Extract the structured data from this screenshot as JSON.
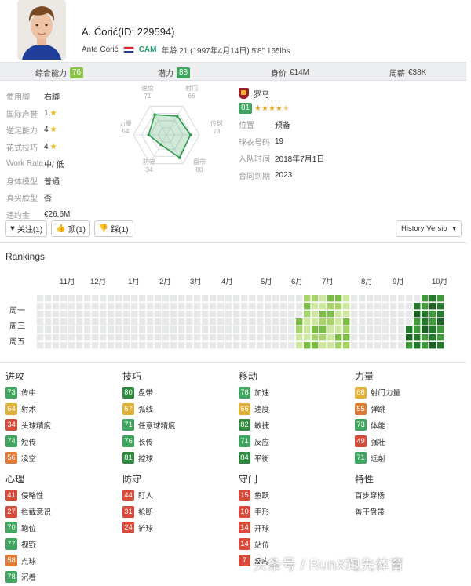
{
  "player": {
    "title": "A. Ćorić(ID: 229594)",
    "full_name": "Ante Ćorić",
    "position": "CAM",
    "details": "年龄 21 (1997年4月14日) 5'8\" 165lbs"
  },
  "stats_bar": {
    "overall_label": "综合能力",
    "overall": "76",
    "potential_label": "潜力",
    "potential": "88",
    "value_label": "身价",
    "value": "€14M",
    "wage_label": "周薪",
    "wage": "€38K"
  },
  "info_left": [
    {
      "label": "惯用脚",
      "value": "右脚"
    },
    {
      "label": "国际声誉",
      "value": "1",
      "stars": 1
    },
    {
      "label": "逆足能力",
      "value": "4",
      "stars": 1
    },
    {
      "label": "花式技巧",
      "value": "4",
      "stars": 1
    },
    {
      "label": "Work Rate",
      "value": "中/ 低"
    },
    {
      "label": "身体模型",
      "value": "普通"
    },
    {
      "label": "真实脸型",
      "value": "否"
    },
    {
      "label": "违约金",
      "value": "€26.6M"
    }
  ],
  "radar": {
    "labels": [
      {
        "name": "射门",
        "value": "66"
      },
      {
        "name": "传球",
        "value": "73"
      },
      {
        "name": "盘带",
        "value": "80"
      },
      {
        "name": "防守",
        "value": "34"
      },
      {
        "name": "力量",
        "value": "54"
      },
      {
        "name": "速度",
        "value": "71"
      }
    ],
    "values": [
      66,
      73,
      80,
      34,
      54,
      71
    ]
  },
  "club": {
    "name": "罗马",
    "rating": "81",
    "stars": 4.5,
    "rows": [
      {
        "label": "位置",
        "value": "预备"
      },
      {
        "label": "球衣号码",
        "value": "19"
      },
      {
        "label": "入队时间",
        "value": "2018年7月1日"
      },
      {
        "label": "合同到期",
        "value": "2023"
      }
    ]
  },
  "buttons": {
    "follow": "关注(1)",
    "up": "顶(1)",
    "down": "踩(1)",
    "history": "History Versio"
  },
  "rankings": {
    "title": "Rankings",
    "months": [
      "11月",
      "12月",
      "1月",
      "2月",
      "3月",
      "4月",
      "5月",
      "6月",
      "7月",
      "8月",
      "9月",
      "10月"
    ],
    "weekdays": [
      "周一",
      "周三",
      "周五"
    ]
  },
  "attributes": {
    "columns": [
      {
        "title": "进攻",
        "items": [
          {
            "value": "73",
            "name": "传中"
          },
          {
            "value": "64",
            "name": "射术"
          },
          {
            "value": "34",
            "name": "头球精度"
          },
          {
            "value": "74",
            "name": "短传"
          },
          {
            "value": "56",
            "name": "凌空"
          }
        ]
      },
      {
        "title": "技巧",
        "items": [
          {
            "value": "80",
            "name": "盘带"
          },
          {
            "value": "67",
            "name": "弧线"
          },
          {
            "value": "71",
            "name": "任意球精度"
          },
          {
            "value": "76",
            "name": "长传"
          },
          {
            "value": "81",
            "name": "控球"
          }
        ]
      },
      {
        "title": "移动",
        "items": [
          {
            "value": "78",
            "name": "加速"
          },
          {
            "value": "66",
            "name": "速度"
          },
          {
            "value": "82",
            "name": "敏捷"
          },
          {
            "value": "71",
            "name": "反应"
          },
          {
            "value": "84",
            "name": "平衡"
          }
        ]
      },
      {
        "title": "力量",
        "items": [
          {
            "value": "68",
            "name": "射门力量"
          },
          {
            "value": "55",
            "name": "弹跳"
          },
          {
            "value": "73",
            "name": "体能"
          },
          {
            "value": "49",
            "name": "强壮"
          },
          {
            "value": "71",
            "name": "远射"
          }
        ]
      },
      {
        "title": "心理",
        "items": [
          {
            "value": "41",
            "name": "侵略性"
          },
          {
            "value": "27",
            "name": "拦截意识"
          },
          {
            "value": "70",
            "name": "跑位"
          },
          {
            "value": "77",
            "name": "视野"
          },
          {
            "value": "58",
            "name": "点球"
          },
          {
            "value": "78",
            "name": "沉着"
          }
        ]
      },
      {
        "title": "防守",
        "items": [
          {
            "value": "44",
            "name": "盯人"
          },
          {
            "value": "31",
            "name": "抢断"
          },
          {
            "value": "24",
            "name": "铲球"
          }
        ]
      },
      {
        "title": "守门",
        "items": [
          {
            "value": "15",
            "name": "鱼跃"
          },
          {
            "value": "10",
            "name": "手形"
          },
          {
            "value": "14",
            "name": "开球"
          },
          {
            "value": "14",
            "name": "站位"
          },
          {
            "value": "7",
            "name": "反应"
          }
        ]
      },
      {
        "title": "特性",
        "traits": [
          "百步穿杨",
          "善于盘带"
        ]
      }
    ]
  },
  "watermark": "头条号 / RunX跑先体育",
  "colors": {
    "green_dark": "#2f8a3f",
    "green": "#3fa55f",
    "green_light": "#8bc34a",
    "yellow": "#e0b139",
    "orange": "#e07a35",
    "red": "#d84a3a"
  }
}
